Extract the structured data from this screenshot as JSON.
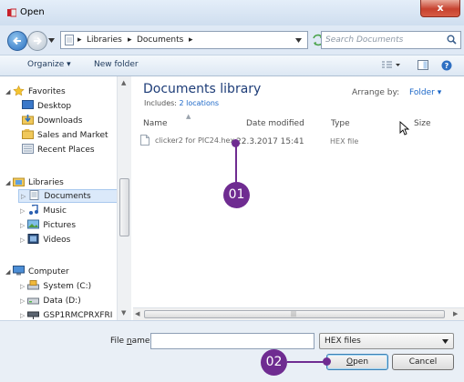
{
  "window": {
    "title": "Open",
    "close_label": "x"
  },
  "navbar": {
    "crumbs": [
      "Libraries",
      "Documents"
    ],
    "search_placeholder": "Search Documents"
  },
  "toolbar": {
    "organize": "Organize ▾",
    "new_folder": "New folder"
  },
  "sidebar": {
    "favorites": {
      "label": "Favorites",
      "items": [
        "Desktop",
        "Downloads",
        "Sales and Market",
        "Recent Places"
      ]
    },
    "libraries": {
      "label": "Libraries",
      "items": [
        "Documents",
        "Music",
        "Pictures",
        "Videos"
      ],
      "selected": "Documents"
    },
    "computer": {
      "label": "Computer",
      "items": [
        "System (C:)",
        "Data (D:)",
        "GSP1RMCPRXFRI"
      ]
    }
  },
  "library": {
    "title": "Documents library",
    "includes_label": "Includes:",
    "includes_link": "2 locations",
    "arrange_label": "Arrange by:",
    "arrange_value": "Folder ▾"
  },
  "columns": {
    "name": "Name",
    "date": "Date modified",
    "type": "Type",
    "size": "Size"
  },
  "files": [
    {
      "name": "clicker2 for PIC24.hex",
      "date": "22.3.2017 15:41",
      "type": "HEX file"
    }
  ],
  "bottom": {
    "filename_label_pre": "File ",
    "filename_label_u": "n",
    "filename_label_post": "ame:",
    "filename_value": "",
    "filter_value": "HEX files",
    "open_u": "O",
    "open_rest": "pen",
    "cancel": "Cancel"
  },
  "callouts": {
    "one": "01",
    "two": "02"
  },
  "colors": {
    "callout": "#6f2c91",
    "link": "#1b67c8",
    "title_blue": "#1e3d78"
  }
}
